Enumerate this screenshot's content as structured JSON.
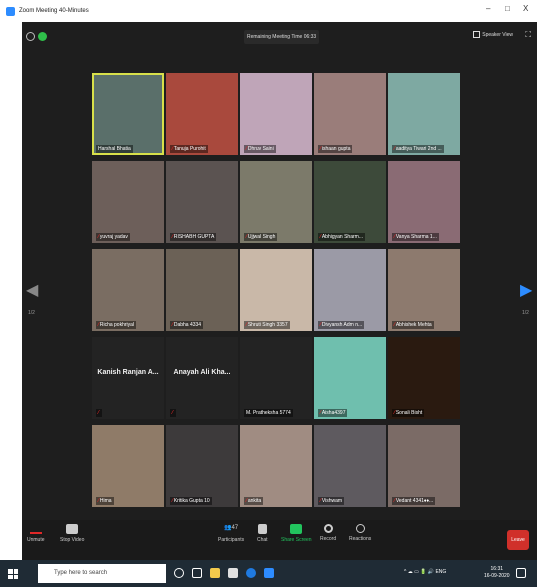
{
  "window": {
    "title": "Zoom Meeting 40-Minutes",
    "minimize": "–",
    "maximize": "□",
    "close": "X"
  },
  "topbar": {
    "remaining": "Remaining Meeting Time 06:33",
    "speaker_view": "Speaker View"
  },
  "participants": [
    {
      "name": "Harshal Bhatia",
      "muted": false,
      "active": true,
      "color": "#5a6f6a"
    },
    {
      "name": "Tanuja Purohit",
      "muted": true,
      "color": "#a9493d"
    },
    {
      "name": "Dhruv Saini",
      "muted": true,
      "color": "#bfa5b8"
    },
    {
      "name": "ishaan gupta",
      "muted": true,
      "color": "#9a7d7a"
    },
    {
      "name": "aaditya Tiwari 2nd ...",
      "muted": true,
      "color": "#7ea9a2"
    },
    {
      "name": "yuvraj yadav",
      "muted": true,
      "color": "#6d5f5a"
    },
    {
      "name": "RISHABH GUPTA",
      "muted": true,
      "color": "#5b5351"
    },
    {
      "name": "Ujjwal Singh",
      "muted": true,
      "color": "#7c7a6a"
    },
    {
      "name": "Abhigyan Sharm...",
      "muted": true,
      "color": "#3d4a3a"
    },
    {
      "name": "Vanya Sharma 1...",
      "muted": true,
      "color": "#8a6b74"
    },
    {
      "name": "Richa pokhriyal",
      "muted": true,
      "color": "#7a6d62"
    },
    {
      "name": "Dabha 4334",
      "muted": true,
      "color": "#6b6156"
    },
    {
      "name": "Shruti Singh 3357",
      "muted": true,
      "color": "#c9b8a8"
    },
    {
      "name": "Divyansh Adm n...",
      "muted": true,
      "color": "#9b9aa6"
    },
    {
      "name": "Abhishek Mehta",
      "muted": true,
      "color": "#8d7a6e"
    },
    {
      "name": "Kanish Ranjan A...",
      "big": "Kanish Ranjan A...",
      "muted": true,
      "color": "#232323",
      "hide_small": true
    },
    {
      "name": "Anayah Ali Kha...",
      "big": "Anayah Ali Kha...",
      "muted": true,
      "color": "#232323",
      "hide_small": true
    },
    {
      "name": "M. Pratheksha 5774",
      "muted": false,
      "color": "#232323"
    },
    {
      "name": "Aisha4397",
      "muted": true,
      "color": "#6fbfae"
    },
    {
      "name": "Sonali Bisht",
      "muted": true,
      "color": "#2a1a10"
    },
    {
      "name": "Hima",
      "muted": true,
      "color": "#8f7b68"
    },
    {
      "name": "Kritika Gupta 10",
      "muted": true,
      "color": "#3d3a3b"
    },
    {
      "name": "ankita",
      "muted": true,
      "color": "#a08c82"
    },
    {
      "name": "Vishwam",
      "muted": true,
      "color": "#5e5a5f"
    },
    {
      "name": "Vedant 4341♦♦...",
      "muted": true,
      "color": "#7b6b66"
    }
  ],
  "pager": {
    "left": "1/2",
    "right": "1/2"
  },
  "toolbar": {
    "unmute": "Unmute",
    "stop_video": "Stop Video",
    "participants": "Participants",
    "participants_count": "47",
    "chat": "Chat",
    "share": "Share Screen",
    "record": "Record",
    "reactions": "Reactions",
    "leave": "Leave"
  },
  "taskbar": {
    "search_placeholder": "Type here to search",
    "lang": "ENG",
    "time": "16:31",
    "date": "16-09-2020"
  },
  "colors": {
    "accent_blue": "#2d8cff",
    "share_green": "#22c55e",
    "leave_red": "#d0302a",
    "active_border": "#d8e04a"
  }
}
